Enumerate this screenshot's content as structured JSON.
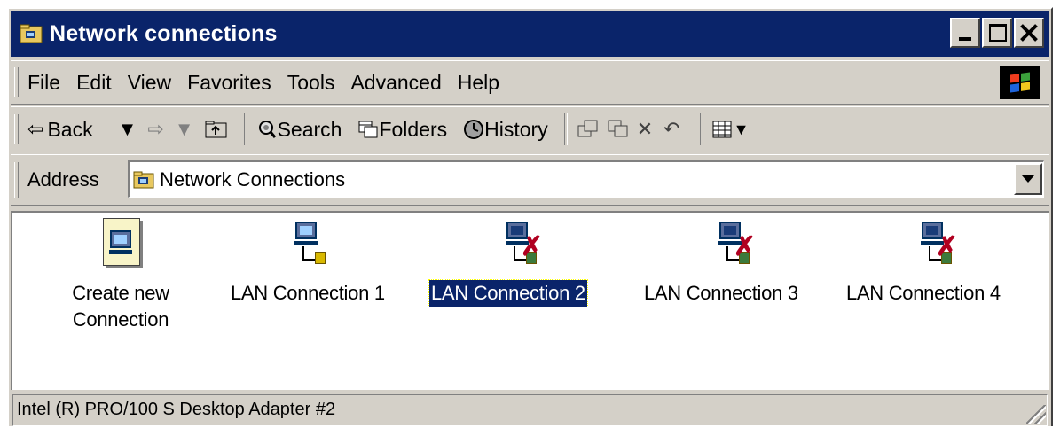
{
  "window": {
    "title": "Network connections",
    "icon": "folder-network-icon",
    "controls": [
      "minimize",
      "maximize",
      "close"
    ]
  },
  "menubar": {
    "items": [
      "File",
      "Edit",
      "View",
      "Favorites",
      "Tools",
      "Advanced",
      "Help"
    ]
  },
  "toolbar": {
    "back_label": "Back",
    "search_label": "Search",
    "folders_label": "Folders",
    "history_label": "History"
  },
  "address": {
    "label": "Address",
    "value": "Network Connections"
  },
  "items": [
    {
      "label": "Create new Connection",
      "icon": "new-connection-icon",
      "selected": false
    },
    {
      "label": "LAN Connection 1",
      "icon": "lan-connected-icon",
      "selected": false
    },
    {
      "label": "LAN Connection 2",
      "icon": "lan-disconnected-icon",
      "selected": true
    },
    {
      "label": "LAN Connection 3",
      "icon": "lan-disconnected-icon",
      "selected": false
    },
    {
      "label": "LAN Connection 4",
      "icon": "lan-disconnected-icon",
      "selected": false
    }
  ],
  "statusbar": {
    "text": "Intel (R) PRO/100 S Desktop Adapter #2"
  },
  "colors": {
    "titlebar": "#0a246a",
    "face": "#d4d0c8",
    "selection": "#0a246a"
  }
}
